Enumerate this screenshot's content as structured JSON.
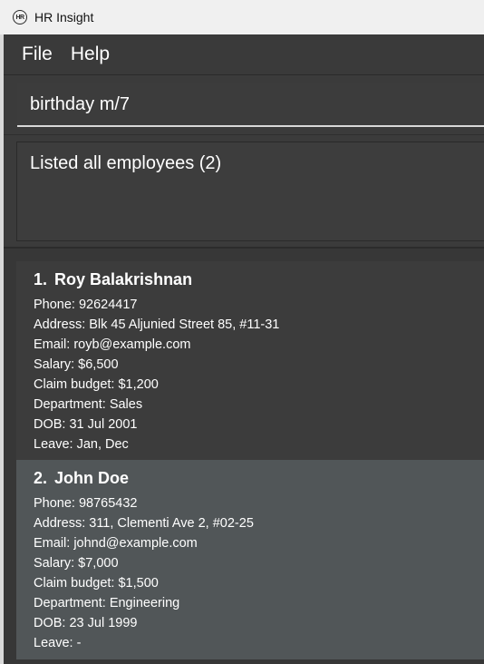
{
  "window": {
    "title": "HR Insight",
    "icon": "hr-logo-icon",
    "icon_text": "HR"
  },
  "menu": {
    "file": "File",
    "help": "Help"
  },
  "command": {
    "value": "birthday m/7"
  },
  "result": {
    "message": "Listed all employees (2)"
  },
  "employees": [
    {
      "index": "1.",
      "name": "Roy Balakrishnan",
      "phone": "Phone: 92624417",
      "address": "Address: Blk 45 Aljunied Street 85, #11-31",
      "email": "Email: royb@example.com",
      "salary": "Salary: $6,500",
      "claim_budget": "Claim budget: $1,200",
      "department": "Department: Sales",
      "dob": "DOB: 31 Jul 2001",
      "leave": "Leave: Jan, Dec"
    },
    {
      "index": "2.",
      "name": "John Doe",
      "phone": "Phone: 98765432",
      "address": "Address: 311, Clementi Ave 2, #02-25",
      "email": "Email: johnd@example.com",
      "salary": "Salary: $7,000",
      "claim_budget": "Claim budget: $1,500",
      "department": "Department: Engineering",
      "dob": "DOB: 23 Jul 1999",
      "leave": "Leave: -"
    }
  ],
  "colors": {
    "background": "#3b3b3b",
    "titlebar": "#f0f0f0",
    "card_odd": "#3c3c3c",
    "card_even": "#515658",
    "text": "#ffffff"
  }
}
